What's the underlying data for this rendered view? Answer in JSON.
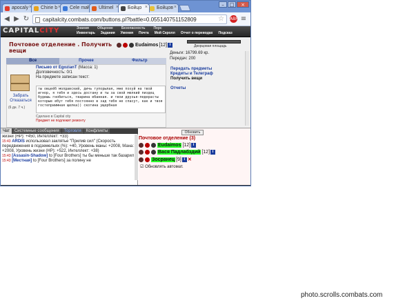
{
  "browser": {
    "tabs": [
      {
        "label": "apocaly",
        "color": "#e23a2a"
      },
      {
        "label": "Chirie b",
        "color": "#e8a21a"
      },
      {
        "label": "Cele mai",
        "color": "#3a78d8"
      },
      {
        "label": "Ultimel",
        "color": "#e05a1a"
      },
      {
        "label": "Бойцо",
        "color": "#444444"
      },
      {
        "label": "Бойцов",
        "color": "#e8c23a"
      }
    ],
    "active_tab": 4,
    "url": "capitalcity.combats.com/buttons.pl?battle=0.055140751152809"
  },
  "game": {
    "logo_a": "CAPITAL",
    "logo_b": "CITY",
    "menu_top": [
      "Знания",
      "Общение",
      "Безопасность",
      "Перс"
    ],
    "menu_bottom": [
      "Инвентарь",
      "Задания",
      "Умения",
      "Почта",
      "Мой Скролл",
      "Отчет о переводах",
      "Подсказ"
    ],
    "stripe_label": "Дворцовая площадь"
  },
  "post": {
    "title": "Почтовое отделение . Получить вещи",
    "user": "Eudaimos",
    "level": "[12]",
    "money": "Деньги: 16799.69 кр.",
    "transfers": "Передач: 200",
    "tabs": [
      "Все",
      "Прочее",
      "Фильтр"
    ],
    "letter": {
      "name": "Письмо от EgozianT",
      "mass": "(Масса: 1)",
      "durability": "Долговечность: 0/1",
      "caption": "На предмете записан текст:",
      "text": "ты овцеёб молдавский, дичь тупорылая, мне похуй на твой игнор, я тебя и здесь достану и ты за свой мелкий пиздец будешь гнобиться, тварина ебанная. и твои друзья-педерасты которые ебут тебя постоянно в зад тебя не спасут, как и твоя гостеприимная щелка)) скотина ущербная",
      "made": "Сделано в Capital city",
      "no_repair": "Предмет не подлежит ремонту",
      "take_label": "Забрать Отказаться",
      "days": "(6 дн. 7 ч.)"
    },
    "actions": [
      "Передать предметы",
      "Кредиты и Телеграф",
      "Получить вещи",
      "",
      "Отчеты"
    ]
  },
  "chat": {
    "tabs": [
      "Чат",
      "Системные сообщения",
      "Торговля",
      "Конфликты"
    ],
    "lines": [
      {
        "ts": "",
        "name": "",
        "text": "жизни (HP): +450, Интеллект: +33)"
      },
      {
        "ts": "",
        "name": "ARDIS",
        "text": "использовал заклятье \"Прилив сил\" (Скорость передвижения в подземельях (%): +40, Уровень маны: +2008, Мана: +2008, Уровень жизни (HP): +522, Интеллект: +38)"
      },
      {
        "ts": "15:43",
        "name": "[Assasin-Shadow]",
        "text": "to [Four Brothers] ты бы меньше так базарил"
      },
      {
        "ts": "15:43",
        "name": "[Местная]",
        "text": "to [Four Brothers] за полину не"
      }
    ],
    "ardis_ts": "15:43"
  },
  "online": {
    "refresh_label": "Обновить",
    "title": "Почтовое отделение (3)",
    "users": [
      {
        "name": "Eudaimos",
        "level": "[12]",
        "highlight": true
      },
      {
        "name": "Вася Падлабздий",
        "level": "[12]",
        "highlight": true
      },
      {
        "name": "Зосранец",
        "level": "[9]",
        "highlight": true
      }
    ],
    "auto_label": "Обновлять автомат."
  },
  "watermark": "photo.scrolls.combats.com"
}
